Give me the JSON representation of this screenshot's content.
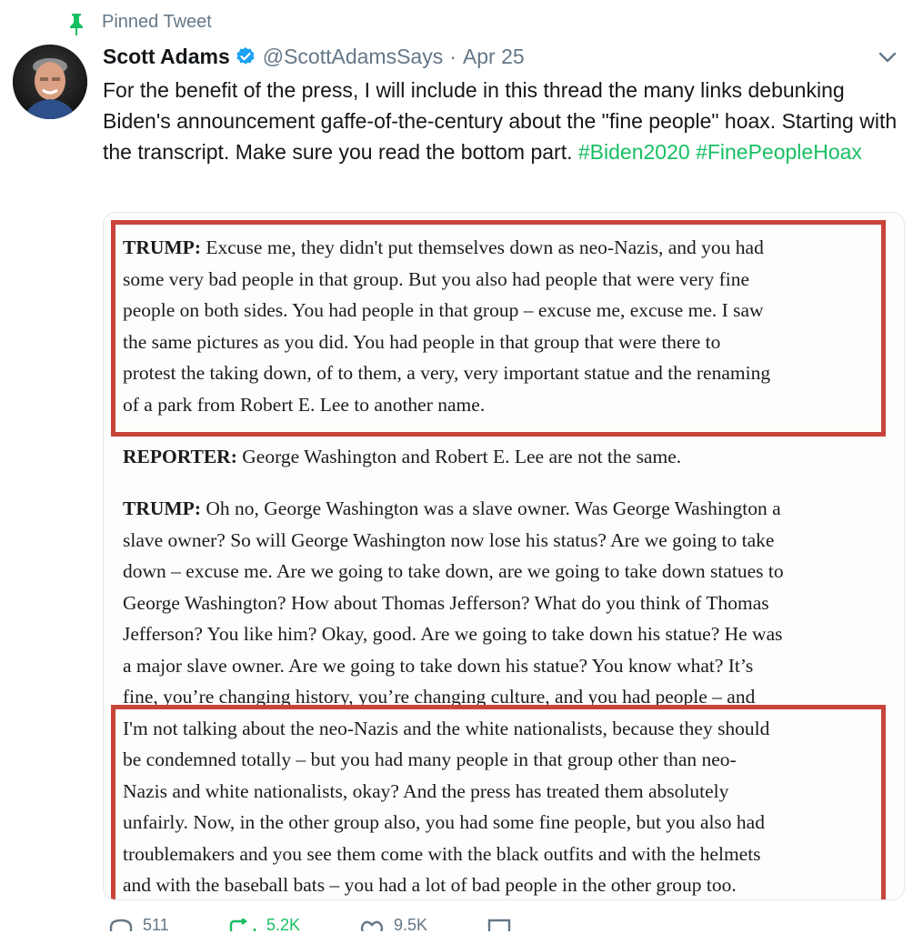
{
  "tweet": {
    "pinned_label": "Pinned Tweet",
    "author_name": "Scott Adams",
    "handle": "@ScottAdamsSays",
    "separator": "·",
    "date": "Apr 25",
    "text_plain": "For the benefit of the press, I will include in this thread the many links debunking Biden's announcement gaffe-of-the-century about the \"fine people\" hoax. Starting with the transcript. Make sure you read the bottom part.",
    "hashtags": [
      "#Biden2020",
      "#FinePeopleHoax"
    ],
    "colors": {
      "accent_green": "#17bf63",
      "verified_blue": "#1da1f2",
      "muted": "#657786",
      "highlight_red": "#c9443a"
    }
  },
  "transcript": {
    "p1_speaker": "TRUMP:",
    "p1_lines": [
      "Excuse me, they didn't put themselves down as neo-Nazis, and you had",
      "some very bad people in that group. But you also had people that were very fine",
      "people on both sides. You had people in that group – excuse me, excuse me. I saw",
      "the same pictures as you did. You had people in that group that were there to",
      "protest the taking down, of to them, a very, very important statue and the renaming",
      "of a park from Robert E. Lee to another name."
    ],
    "p2_speaker": "REPORTER:",
    "p2_text": "George Washington and Robert E. Lee are not the same.",
    "p3_speaker": "TRUMP:",
    "p3_lines": [
      "Oh no, George Washington was a slave owner. Was George Washington a",
      "slave owner? So will George Washington now lose his status? Are we going to take",
      "down – excuse me. Are we going to take down, are we going to take down statues to",
      "George Washington? How about Thomas Jefferson? What do you think of Thomas",
      "Jefferson? You like him? Okay, good. Are we going to take down his statue? He was",
      "a major slave owner. Are we going to take down his statue? You know what? It’s",
      "fine, you’re changing history, you’re changing culture, and you had people – and",
      "I'm not talking about the neo-Nazis and the white nationalists, because they should",
      "be condemned totally – but you had many people in that group other than neo-",
      "Nazis and white nationalists, okay? And the press has treated them absolutely",
      "unfairly. Now, in the other group also, you had some fine people, but you also had",
      "troublemakers and you see them come with the black outfits and with the helmets",
      "and with the baseball bats – you had a lot of bad people in the other group too."
    ]
  },
  "actions": {
    "icons": [
      "reply-icon",
      "retweet-icon",
      "like-icon",
      "share-icon"
    ],
    "counts": [
      "511",
      "5.2K",
      "9.5K"
    ]
  }
}
